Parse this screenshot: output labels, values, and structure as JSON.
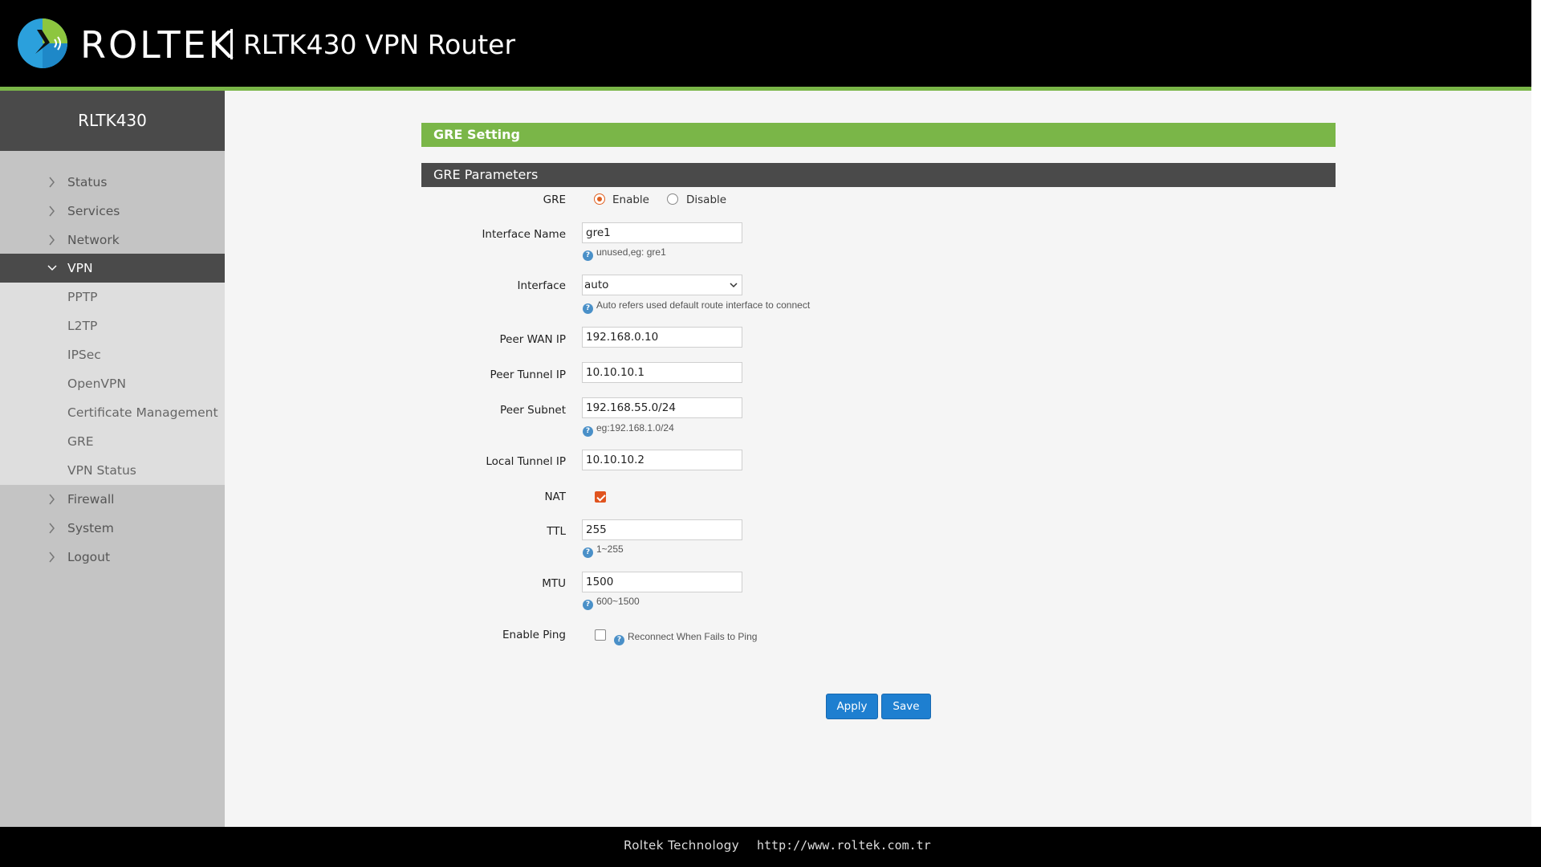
{
  "header": {
    "brand": "ROLTEK",
    "product": "RLTK430 VPN Router"
  },
  "sidebar": {
    "device": "RLTK430",
    "items": [
      {
        "label": "Status"
      },
      {
        "label": "Services"
      },
      {
        "label": "Network"
      },
      {
        "label": "VPN"
      },
      {
        "label": "Firewall"
      },
      {
        "label": "System"
      },
      {
        "label": "Logout"
      }
    ],
    "vpn_subitems": [
      {
        "label": "PPTP"
      },
      {
        "label": "L2TP"
      },
      {
        "label": "IPSec"
      },
      {
        "label": "OpenVPN"
      },
      {
        "label": "Certificate Management"
      },
      {
        "label": "GRE"
      },
      {
        "label": "VPN Status"
      }
    ]
  },
  "page": {
    "section_title": "GRE Setting",
    "panel_title": "GRE Parameters"
  },
  "form": {
    "gre": {
      "label": "GRE",
      "enable_label": "Enable",
      "disable_label": "Disable",
      "selected": "Enable"
    },
    "interface_name": {
      "label": "Interface Name",
      "value": "gre1",
      "hint": "unused,eg: gre1"
    },
    "interface": {
      "label": "Interface",
      "value": "auto",
      "hint": "Auto refers used default route interface to connect"
    },
    "peer_wan_ip": {
      "label": "Peer WAN IP",
      "value": "192.168.0.10"
    },
    "peer_tunnel_ip": {
      "label": "Peer Tunnel IP",
      "value": "10.10.10.1"
    },
    "peer_subnet": {
      "label": "Peer Subnet",
      "value": "192.168.55.0/24",
      "hint": "eg:192.168.1.0/24"
    },
    "local_tunnel_ip": {
      "label": "Local Tunnel IP",
      "value": "10.10.10.2"
    },
    "nat": {
      "label": "NAT",
      "checked": true
    },
    "ttl": {
      "label": "TTL",
      "value": "255",
      "hint": "1~255"
    },
    "mtu": {
      "label": "MTU",
      "value": "1500",
      "hint": "600~1500"
    },
    "enable_ping": {
      "label": "Enable Ping",
      "checked": false,
      "hint": "Reconnect When Fails to Ping"
    }
  },
  "buttons": {
    "apply": "Apply",
    "save": "Save"
  },
  "footer": {
    "company": "Roltek Technology",
    "url": "http://www.roltek.com.tr"
  },
  "colors": {
    "accent_green": "#7ab648",
    "dark_bar": "#4a4a4a",
    "button_blue": "#1e7fd0",
    "check_orange": "#e0541f"
  },
  "icons": {
    "logo": "roltek-logo-icon",
    "nav_collapsed": "chevron-right-icon",
    "nav_expanded": "chevron-down-icon",
    "hint": "info-icon"
  }
}
